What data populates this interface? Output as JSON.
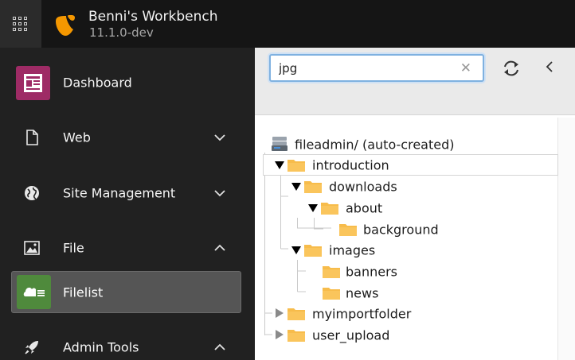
{
  "topbar": {
    "site_name": "Benni's Workbench",
    "version": "11.1.0-dev",
    "icons": [
      "grid-menu-icon",
      "typo3-logo-icon"
    ]
  },
  "sidebar": {
    "items": [
      {
        "label": "Dashboard",
        "icon": "dashboard-icon",
        "state": "none"
      },
      {
        "label": "Web",
        "icon": "page-icon",
        "state": "collapsed"
      },
      {
        "label": "Site Management",
        "icon": "globe-icon",
        "state": "collapsed"
      },
      {
        "label": "File",
        "icon": "image-icon",
        "state": "expanded"
      },
      {
        "label": "Filelist",
        "icon": "filelist-icon",
        "state": "active"
      },
      {
        "label": "Admin Tools",
        "icon": "rocket-icon",
        "state": "expanded"
      }
    ]
  },
  "tree": {
    "search_value": "jpg",
    "root": "fileadmin/ (auto-created)",
    "nodes": [
      {
        "label": "introduction",
        "level": 1,
        "expanded": true,
        "selected": true
      },
      {
        "label": "downloads",
        "level": 2,
        "expanded": true
      },
      {
        "label": "about",
        "level": 3,
        "expanded": true
      },
      {
        "label": "background",
        "level": 4
      },
      {
        "label": "images",
        "level": 2,
        "expanded": true
      },
      {
        "label": "banners",
        "level": 3
      },
      {
        "label": "news",
        "level": 3
      },
      {
        "label": "myimportfolder",
        "level": 1,
        "expanded": false
      },
      {
        "label": "user_upload",
        "level": 1,
        "expanded": false
      }
    ]
  },
  "colors": {
    "topbar": "#151515",
    "sidebar": "#212121",
    "dashboard_accent": "#9e2b65",
    "filelist_accent": "#4f8a3c",
    "folder": "#f7bc4b"
  }
}
